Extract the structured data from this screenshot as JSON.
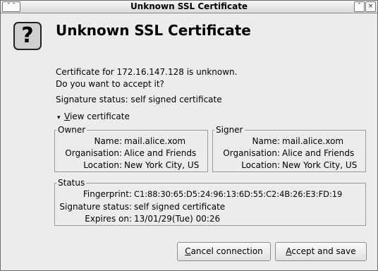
{
  "window": {
    "title": "Unknown SSL Certificate",
    "left_controls": "ˇ ˆ",
    "right_controls": [
      "ˆ",
      "×"
    ]
  },
  "dialog": {
    "icon": "question-icon",
    "icon_glyph": "?",
    "heading": "Unknown SSL Certificate",
    "line1": "Certificate for 172.16.147.128 is unknown.",
    "line2": "Do you want to accept it?",
    "signature_line": "Signature status: self signed certificate",
    "expander": {
      "arrow": "▾",
      "label_prefix": "V",
      "label_rest": "iew certificate"
    }
  },
  "owner": {
    "legend": "Owner",
    "name_label": "Name:",
    "name_value": "mail.alice.xom",
    "org_label": "Organisation:",
    "org_value": "Alice and Friends",
    "loc_label": "Location:",
    "loc_value": "New York City, US"
  },
  "signer": {
    "legend": "Signer",
    "name_label": "Name:",
    "name_value": "mail.alice.xom",
    "org_label": "Organisation:",
    "org_value": "Alice and Friends",
    "loc_label": "Location:",
    "loc_value": "New York City, US"
  },
  "status": {
    "legend": "Status",
    "fp_label": "Fingerprint:",
    "fp_value": "C1:88:30:65:D5:24:96:13:6D:55:C2:4B:26:E3:FD:19",
    "sig_label": "Signature status:",
    "sig_value": "self signed certificate",
    "exp_label": "Expires on:",
    "exp_value": "13/01/29(Tue) 00:26"
  },
  "buttons": {
    "cancel_prefix": "C",
    "cancel_rest": "ancel connection",
    "accept_prefix": "A",
    "accept_rest": "ccept and save"
  }
}
